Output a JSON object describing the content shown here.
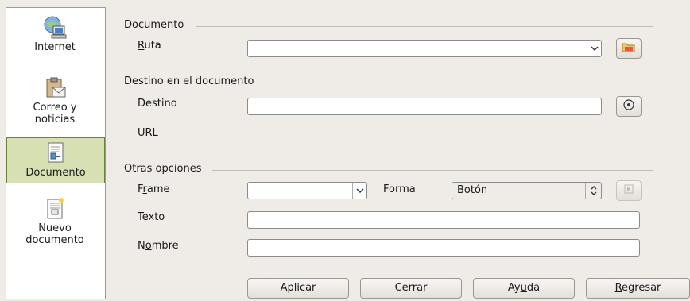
{
  "sidebar": {
    "items": [
      {
        "label_line1": "Internet",
        "label_line2": "",
        "icon": "globe-monitor-icon",
        "selected": false
      },
      {
        "label_line1": "Correo y",
        "label_line2": "noticias",
        "icon": "mail-clipboard-icon",
        "selected": false
      },
      {
        "label_line1": "Documento",
        "label_line2": "",
        "icon": "document-link-icon",
        "selected": true
      },
      {
        "label_line1": "Nuevo",
        "label_line2": "documento",
        "icon": "new-document-icon",
        "selected": false
      }
    ]
  },
  "sections": {
    "documento": {
      "title": "Documento",
      "ruta": {
        "label_prefix": "",
        "label_mnemonic": "R",
        "label_rest": "uta",
        "value": ""
      }
    },
    "destino": {
      "title": "Destino en el documento",
      "destino_label": "Destino",
      "destino_value": "",
      "url_label": "URL"
    },
    "otras": {
      "title": "Otras opciones",
      "frame": {
        "label_prefix": "F",
        "label_mnemonic": "r",
        "label_rest": "ame",
        "value": ""
      },
      "forma": {
        "label": "Forma",
        "value": "Botón"
      },
      "texto": {
        "label": "Texto",
        "value": ""
      },
      "nombre": {
        "label_prefix": "N",
        "label_mnemonic": "o",
        "label_rest": "mbre",
        "value": ""
      }
    }
  },
  "buttons": {
    "aplicar": "Aplicar",
    "cerrar": "Cerrar",
    "ayuda_prefix": "Ay",
    "ayuda_mnemonic": "u",
    "ayuda_rest": "da",
    "regresar_mnemonic": "R",
    "regresar_rest": "egresar"
  },
  "colors": {
    "window_bg": "#efebe7",
    "selected_item_bg": "#d6e0b3",
    "selected_item_border": "#6d7f3a"
  }
}
